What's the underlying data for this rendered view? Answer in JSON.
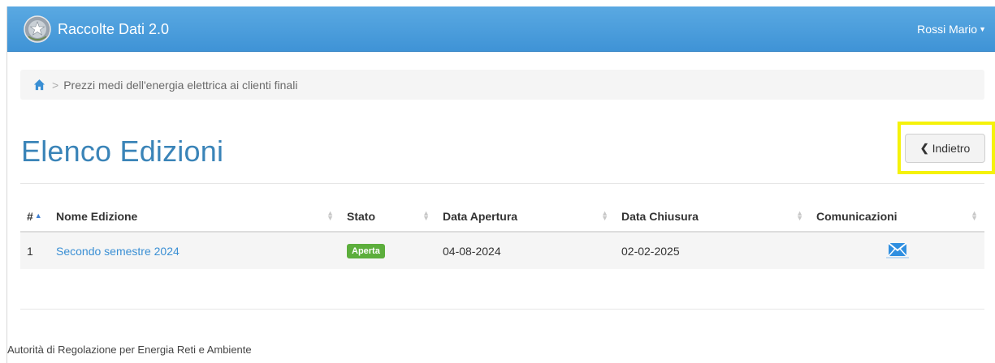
{
  "navbar": {
    "brand_title": "Raccolte Dati 2.0",
    "user_name": "Rossi Mario",
    "emblem_icon": "republic-emblem-icon",
    "caret_icon": "caret-down-icon"
  },
  "breadcrumb": {
    "home_icon": "home-icon",
    "separator": ">",
    "current": "Prezzi medi dell'energia elettrica ai clienti finali"
  },
  "page": {
    "title": "Elenco Edizioni",
    "back_label": "Indietro",
    "back_icon": "chevron-left-icon"
  },
  "table": {
    "columns": [
      "#",
      "Nome Edizione",
      "Stato",
      "Data Apertura",
      "Data Chiusura",
      "Comunicazioni"
    ],
    "rows": [
      {
        "num": "1",
        "nome": "Secondo semestre 2024",
        "stato": "Aperta",
        "apertura": "04-08-2024",
        "chiusura": "02-02-2025",
        "comunicazioni_icon": "mail-icon"
      }
    ]
  },
  "footer": {
    "text": "Autorità di Regolazione per Energia Reti e Ambiente"
  },
  "colors": {
    "navbar": "#4a9fdc",
    "title": "#3a84b8",
    "link": "#3a8fd4",
    "badge": "#5cae3c",
    "highlight": "#f5f20a"
  }
}
